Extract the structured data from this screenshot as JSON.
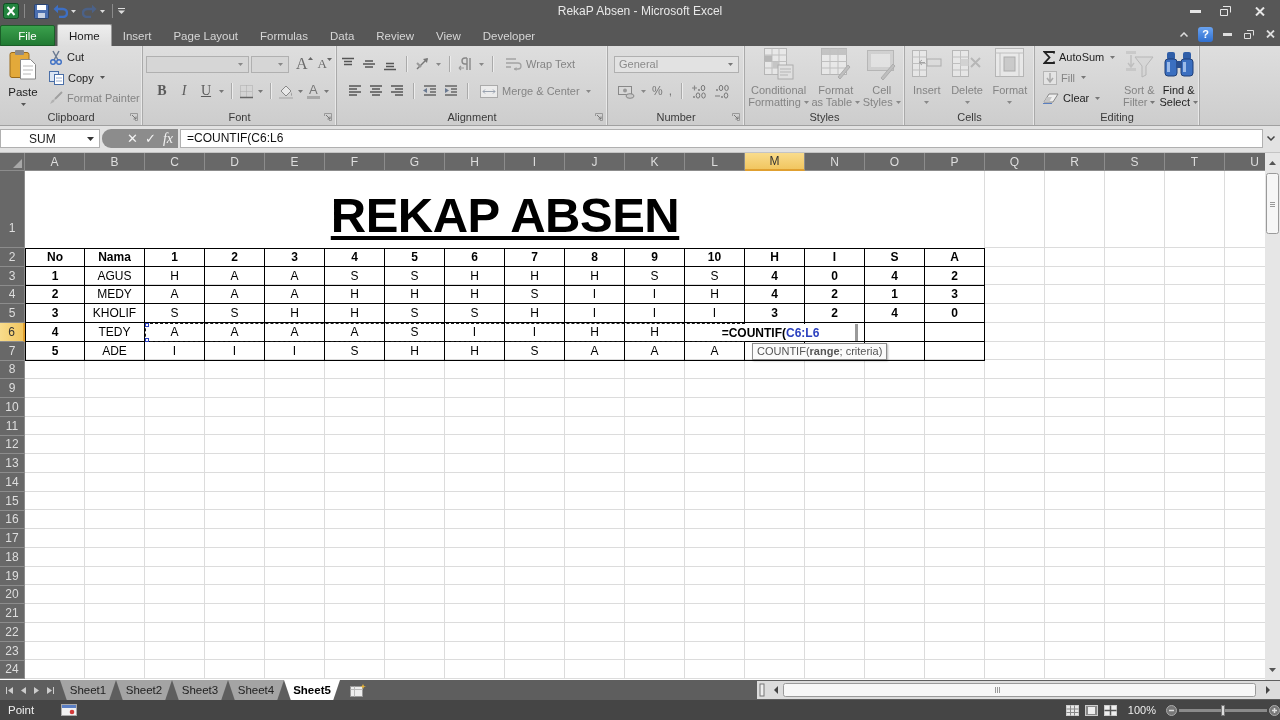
{
  "window": {
    "title": "RekaP Absen - Microsoft Excel",
    "help": "?"
  },
  "quick_access": [
    {
      "kind": "save",
      "disabled": false,
      "dropdown": false
    },
    {
      "kind": "undo",
      "disabled": false,
      "dropdown": true
    },
    {
      "kind": "redo",
      "disabled": true,
      "dropdown": true
    }
  ],
  "ribbon_tabs": [
    {
      "label": "File",
      "kind": "file",
      "selected": false
    },
    {
      "label": "Home",
      "kind": "tab",
      "selected": true
    },
    {
      "label": "Insert",
      "kind": "tab",
      "selected": false
    },
    {
      "label": "Page Layout",
      "kind": "tab",
      "selected": false
    },
    {
      "label": "Formulas",
      "kind": "tab",
      "selected": false
    },
    {
      "label": "Data",
      "kind": "tab",
      "selected": false
    },
    {
      "label": "Review",
      "kind": "tab",
      "selected": false
    },
    {
      "label": "View",
      "kind": "tab",
      "selected": false
    },
    {
      "label": "Developer",
      "kind": "tab",
      "selected": false
    }
  ],
  "ribbon": {
    "clipboard": {
      "label": "Clipboard",
      "paste": {
        "lines": [
          "Paste"
        ],
        "disabled": false,
        "dropdown": true
      },
      "buttons": [
        {
          "kind": "cut",
          "label": "Cut",
          "disabled": false,
          "dropdown": false
        },
        {
          "kind": "copy",
          "label": "Copy",
          "disabled": false,
          "dropdown": true
        },
        {
          "kind": "painter",
          "label": "Format Painter",
          "disabled": true,
          "dropdown": false
        }
      ]
    },
    "font": {
      "label": "Font",
      "font_name": {
        "disabled": true
      },
      "font_size": {
        "disabled": true
      },
      "size_buttons": [
        "A",
        "A"
      ],
      "style_buttons": [
        "B",
        "I",
        "U"
      ],
      "font_color": "A"
    },
    "alignment": {
      "label": "Alignment",
      "buttons": [
        {
          "kind": "wrap",
          "label": "Wrap Text",
          "disabled": true,
          "dropdown": false
        },
        {
          "kind": "merge",
          "label": "Merge & Center",
          "disabled": true,
          "dropdown": true
        }
      ]
    },
    "number": {
      "label": "Number",
      "format": {
        "value": "General",
        "disabled": true
      },
      "symbols": [
        "%",
        ","
      ]
    },
    "styles": {
      "label": "Styles",
      "buttons": [
        {
          "kind": "conditional",
          "lines": [
            "Conditional",
            "Formatting"
          ],
          "disabled": true,
          "dropdown": true
        },
        {
          "kind": "table",
          "lines": [
            "Format",
            "as Table"
          ],
          "disabled": true,
          "dropdown": true
        },
        {
          "kind": "cellstyles",
          "lines": [
            "Cell",
            "Styles"
          ],
          "disabled": true,
          "dropdown": true
        }
      ]
    },
    "cells": {
      "label": "Cells",
      "buttons": [
        {
          "kind": "insert",
          "lines": [
            "Insert"
          ],
          "disabled": true,
          "dropdown": true
        },
        {
          "kind": "delete",
          "lines": [
            "Delete"
          ],
          "disabled": true,
          "dropdown": true
        },
        {
          "kind": "format",
          "lines": [
            "Format"
          ],
          "disabled": true,
          "dropdown": true
        }
      ]
    },
    "editing": {
      "label": "Editing",
      "buttons": [
        {
          "kind": "autosum",
          "label": "AutoSum",
          "disabled": false,
          "dropdown": true
        },
        {
          "kind": "fill",
          "label": "Fill",
          "disabled": true,
          "dropdown": true
        },
        {
          "kind": "clear",
          "label": "Clear",
          "disabled": false,
          "dropdown": true
        }
      ],
      "large": [
        {
          "kind": "sort",
          "lines": [
            "Sort &",
            "Filter"
          ],
          "disabled": true,
          "dropdown": true
        },
        {
          "kind": "find",
          "lines": [
            "Find &",
            "Select"
          ],
          "disabled": false,
          "dropdown": true
        }
      ]
    }
  },
  "formula_bar": {
    "name_box": "SUM",
    "buttons": [
      "✕",
      "✓",
      "fx"
    ],
    "formula": "=COUNTIF(C6:L6"
  },
  "sheet": {
    "columns": [
      {
        "label": "A",
        "selected": false
      },
      {
        "label": "B",
        "selected": false
      },
      {
        "label": "C",
        "selected": false
      },
      {
        "label": "D",
        "selected": false
      },
      {
        "label": "E",
        "selected": false
      },
      {
        "label": "F",
        "selected": false
      },
      {
        "label": "G",
        "selected": false
      },
      {
        "label": "H",
        "selected": false
      },
      {
        "label": "I",
        "selected": false
      },
      {
        "label": "J",
        "selected": false
      },
      {
        "label": "K",
        "selected": false
      },
      {
        "label": "L",
        "selected": false
      },
      {
        "label": "M",
        "selected": true
      },
      {
        "label": "N",
        "selected": false
      },
      {
        "label": "O",
        "selected": false
      },
      {
        "label": "P",
        "selected": false
      },
      {
        "label": "Q",
        "selected": false
      },
      {
        "label": "R",
        "selected": false
      },
      {
        "label": "S",
        "selected": false
      },
      {
        "label": "T",
        "selected": false
      },
      {
        "label": "U",
        "selected": false
      }
    ],
    "rows": [
      {
        "label": "1",
        "selected": false
      },
      {
        "label": "2",
        "selected": false
      },
      {
        "label": "3",
        "selected": false
      },
      {
        "label": "4",
        "selected": false
      },
      {
        "label": "5",
        "selected": false
      },
      {
        "label": "6",
        "selected": true
      },
      {
        "label": "7",
        "selected": false
      },
      {
        "label": "8",
        "selected": false
      },
      {
        "label": "9",
        "selected": false
      },
      {
        "label": "10",
        "selected": false
      },
      {
        "label": "11",
        "selected": false
      },
      {
        "label": "12",
        "selected": false
      },
      {
        "label": "13",
        "selected": false
      },
      {
        "label": "14",
        "selected": false
      },
      {
        "label": "15",
        "selected": false
      },
      {
        "label": "16",
        "selected": false
      },
      {
        "label": "17",
        "selected": false
      },
      {
        "label": "18",
        "selected": false
      },
      {
        "label": "19",
        "selected": false
      },
      {
        "label": "20",
        "selected": false
      },
      {
        "label": "21",
        "selected": false
      },
      {
        "label": "22",
        "selected": false
      },
      {
        "label": "23",
        "selected": false
      },
      {
        "label": "24",
        "selected": false
      }
    ],
    "title": "REKAP ABSEN",
    "table": {
      "header": [
        "No",
        "Nama",
        "1",
        "2",
        "3",
        "4",
        "5",
        "6",
        "7",
        "8",
        "9",
        "10",
        "H",
        "I",
        "S",
        "A"
      ],
      "rows": [
        {
          "cells": [
            "1",
            "AGUS",
            "H",
            "A",
            "A",
            "S",
            "S",
            "H",
            "H",
            "H",
            "S",
            "S",
            "4",
            "0",
            "4",
            "2"
          ]
        },
        {
          "cells": [
            "2",
            "MEDY",
            "A",
            "A",
            "A",
            "H",
            "H",
            "H",
            "S",
            "I",
            "I",
            "H",
            "4",
            "2",
            "1",
            "3"
          ]
        },
        {
          "cells": [
            "3",
            "KHOLIF",
            "S",
            "S",
            "H",
            "H",
            "S",
            "S",
            "H",
            "I",
            "I",
            "I",
            "3",
            "2",
            "4",
            "0"
          ]
        },
        {
          "cells": [
            "4",
            "TEDY",
            "A",
            "A",
            "A",
            "A",
            "S",
            "I",
            "I",
            "H",
            "H"
          ]
        },
        {
          "cells": [
            "5",
            "ADE",
            "I",
            "I",
            "I",
            "S",
            "H",
            "H",
            "S",
            "A",
            "A",
            "A"
          ]
        }
      ]
    },
    "cell_editor": {
      "formula": "=COUNTIF(",
      "reference": "C6:L6"
    },
    "tooltip": "COUNTIF(**range**; criteria)"
  },
  "sheet_tabs": [
    {
      "label": "Sheet1",
      "selected": false
    },
    {
      "label": "Sheet2",
      "selected": false
    },
    {
      "label": "Sheet3",
      "selected": false
    },
    {
      "label": "Sheet4",
      "selected": false
    },
    {
      "label": "Sheet5",
      "selected": true
    }
  ],
  "status_bar": {
    "mode": "Point",
    "zoom": "100%",
    "zoom_slider": {
      "level": 0.5
    }
  }
}
